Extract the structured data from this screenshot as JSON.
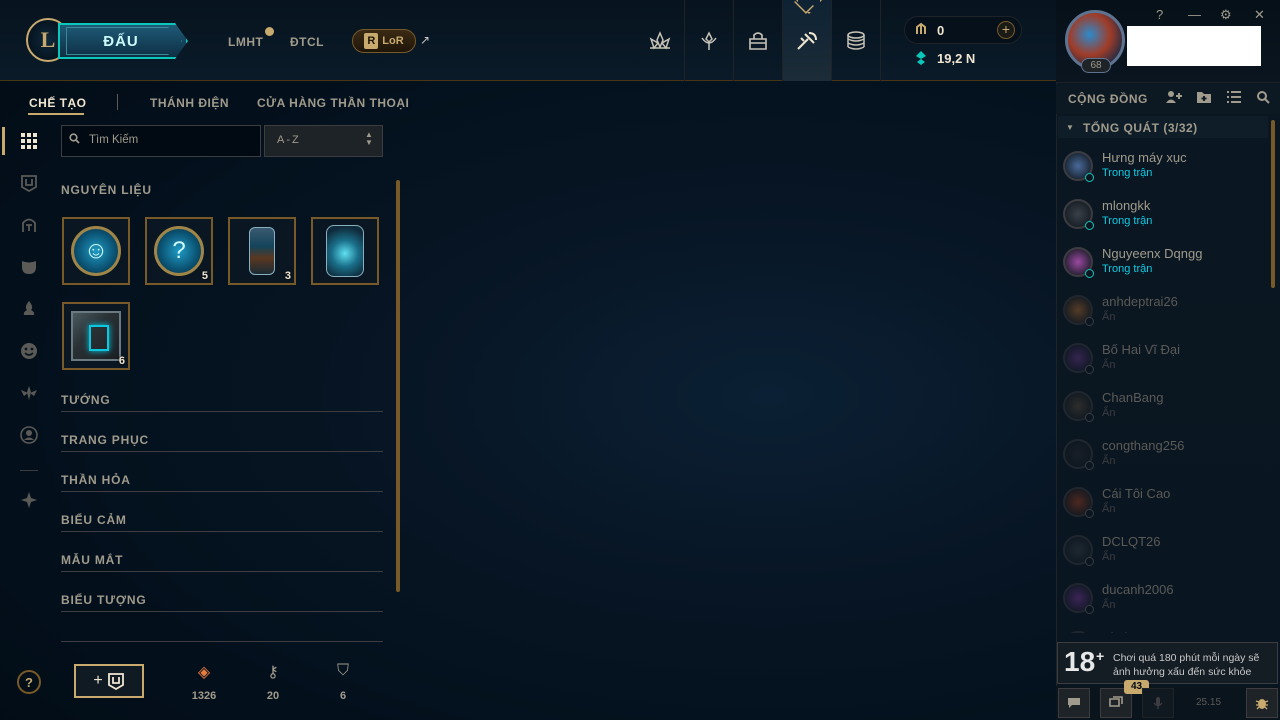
{
  "topbar": {
    "logo": "L",
    "play_label": "ĐẤU",
    "games": [
      "LMHT",
      "ĐTCL"
    ],
    "lor_label": "LoR",
    "lor_letter": "R",
    "lor_arrow": "↗",
    "nav_icons": [
      "home-icon",
      "profile-icon",
      "collection-icon",
      "loot-icon",
      "store-icon"
    ],
    "rp_value": "0",
    "rp_add": "+",
    "be_value": "19,2 N"
  },
  "profile": {
    "level": "68"
  },
  "window_controls": [
    "?",
    "—",
    "⚙",
    "✕"
  ],
  "subnav": {
    "tabs": [
      "CHẾ TẠO",
      "THÁNH ĐIỆN",
      "CỬA HÀNG THẦN THOẠI"
    ]
  },
  "loot": {
    "search_placeholder": "Tìm Kiếm",
    "sort_value": "A-Z",
    "categories": [
      "NGUYÊN LIỆU",
      "TƯỚNG",
      "TRANG PHỤC",
      "THẦN HỎA",
      "BIỂU CẢM",
      "MẪU MẮT",
      "BIỂU TƯỢNG"
    ],
    "items": [
      {
        "kind": "emote-orb",
        "glyph": "☺",
        "count": ""
      },
      {
        "kind": "emote-orb",
        "glyph": "?",
        "count": "5"
      },
      {
        "kind": "capsule",
        "count": "3"
      },
      {
        "kind": "capsule-big",
        "count": ""
      },
      {
        "kind": "chest",
        "count": "6"
      }
    ],
    "help": "?",
    "add_plus": "+",
    "resources": [
      {
        "icon": "essence-icon",
        "glyph": "◈",
        "color": "#e87c3e",
        "value": "1326"
      },
      {
        "icon": "key-icon",
        "glyph": "⚷",
        "color": "#a09b8c",
        "value": "20"
      },
      {
        "icon": "chest-icon",
        "glyph": "⛉",
        "color": "#a09b8c",
        "value": "6"
      }
    ]
  },
  "social": {
    "title": "CỘNG ĐỒNG",
    "group": "TỔNG QUÁT (3/32)",
    "friends": [
      {
        "name": "Hưng máy xục",
        "status": "Trong trận",
        "online": true,
        "color": "#4a6a9a"
      },
      {
        "name": "mlongkk",
        "status": "Trong trận",
        "online": true,
        "color": "#3a4048"
      },
      {
        "name": "Nguyeenx Dqngg",
        "status": "Trong trận",
        "online": true,
        "color": "#9a4aa0"
      },
      {
        "name": "anhdeptrai26",
        "status": "Ẩn",
        "online": false,
        "color": "#b06a30"
      },
      {
        "name": "Bố Hai Vĩ Đại",
        "status": "Ẩn",
        "online": false,
        "color": "#6a3a8a"
      },
      {
        "name": "ChanBang",
        "status": "Ẩn",
        "online": false,
        "color": "#5a4a3a"
      },
      {
        "name": "congthang256",
        "status": "Ẩn",
        "online": false,
        "color": "#2a2a30"
      },
      {
        "name": "Cái Tôi Cao",
        "status": "Ẩn",
        "online": false,
        "color": "#a04020"
      },
      {
        "name": "DCLQT26",
        "status": "Ẩn",
        "online": false,
        "color": "#3a4048"
      },
      {
        "name": "ducanh2006",
        "status": "Ẩn",
        "online": false,
        "color": "#7a3a9a"
      },
      {
        "name": "Elmi",
        "status": "",
        "online": false,
        "color": "#3a4048"
      }
    ],
    "notice_age": "18",
    "notice_plus": "+",
    "notice_text": "Chơi quá 180 phút mỗi ngày sẽ ảnh hưởng xấu đến sức khỏe",
    "badge_count": "43",
    "version": "25.15"
  },
  "colors": {
    "gold": "#c8aa6e",
    "teal": "#0ac8b9",
    "background": "#010a13"
  }
}
